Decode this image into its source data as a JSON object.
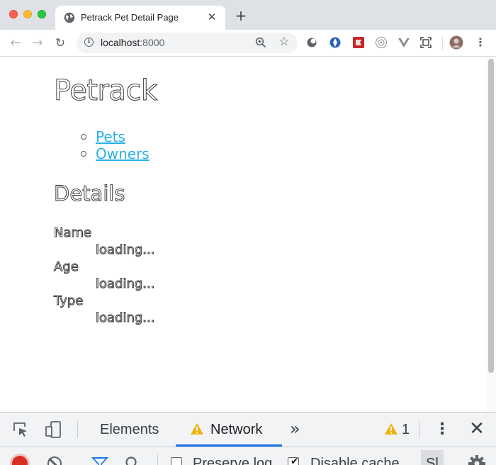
{
  "browser": {
    "tab_title": "Petrack Pet Detail Page",
    "url_host": "localhost",
    "url_port": ":8000"
  },
  "page": {
    "title": "Petrack",
    "nav": [
      {
        "label": "Pets"
      },
      {
        "label": "Owners"
      }
    ],
    "section_title": "Details",
    "details": [
      {
        "term": "Name",
        "value": "loading..."
      },
      {
        "term": "Age",
        "value": "loading..."
      },
      {
        "term": "Type",
        "value": "loading..."
      }
    ]
  },
  "devtools": {
    "tabs": [
      {
        "label": "Elements",
        "active": false
      },
      {
        "label": "Network",
        "active": true
      }
    ],
    "more_label": "»",
    "warning_count": "1",
    "toolbar": {
      "preserve_log_label": "Preserve log",
      "preserve_log_checked": false,
      "disable_cache_label": "Disable cache",
      "disable_cache_checked": true,
      "throttling_label": "Sl"
    }
  },
  "colors": {
    "link": "#2ab1e8",
    "active_tab_underline": "#1a73e8",
    "record": "#d93025",
    "warning": "#f2b30f"
  }
}
